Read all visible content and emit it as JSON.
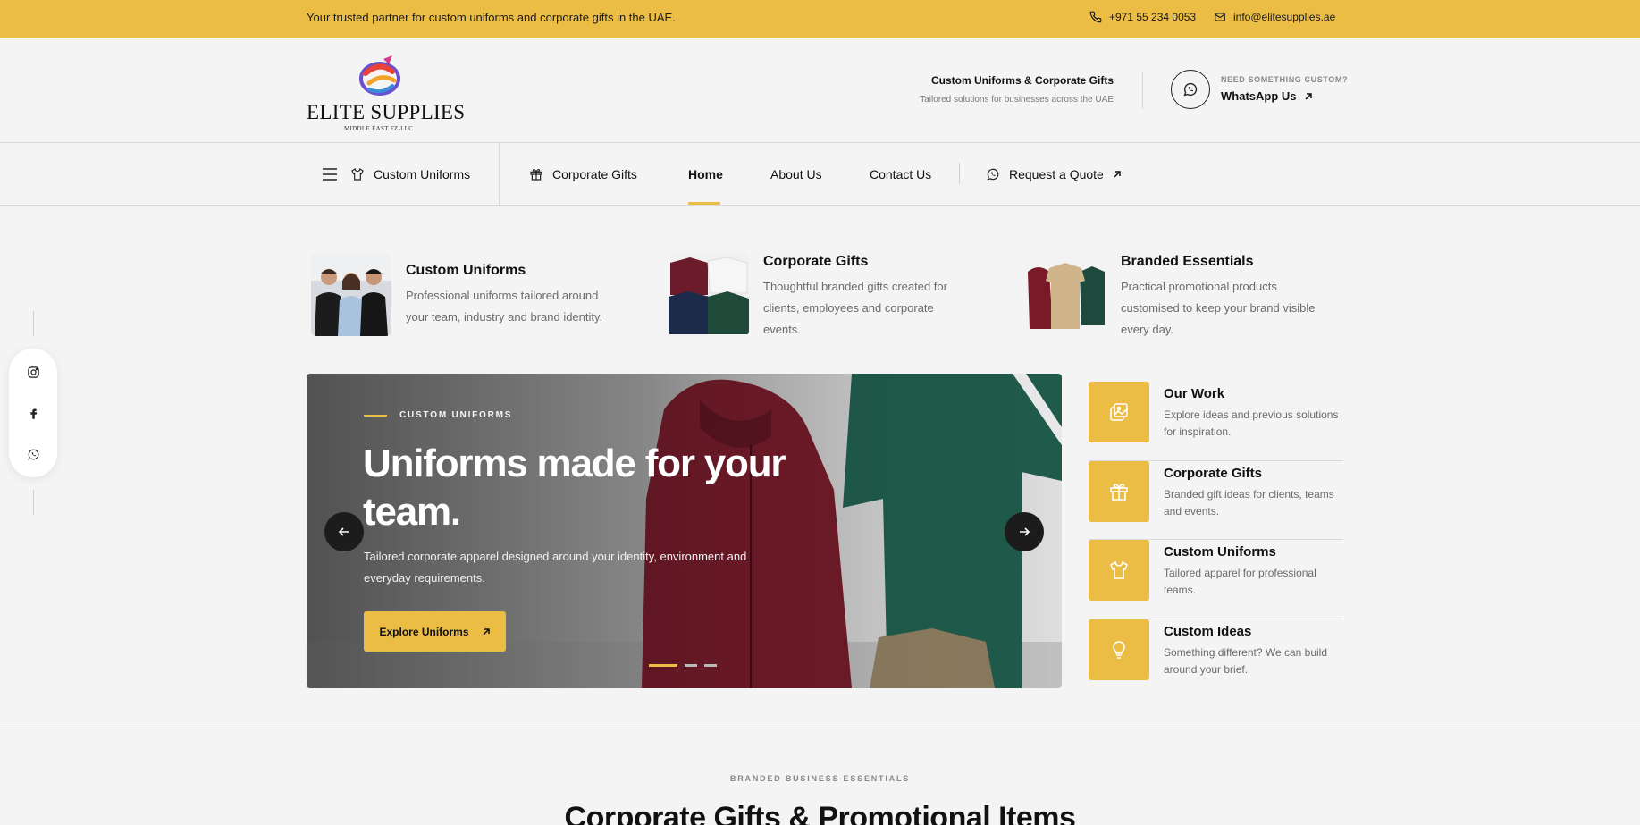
{
  "topbar": {
    "tagline": "Your trusted partner for custom uniforms and corporate gifts in the UAE.",
    "phone": "+971 55 234 0053",
    "email": "info@elitesupplies.ae"
  },
  "logo": {
    "name": "ELITE SUPPLIES",
    "sub": "MIDDLE EAST FZ-LLC"
  },
  "header": {
    "info_title": "Custom Uniforms & Corporate Gifts",
    "info_sub": "Tailored solutions for businesses across the UAE",
    "whatsapp_small": "NEED SOMETHING CUSTOM?",
    "whatsapp_label": "WhatsApp Us"
  },
  "nav": {
    "uniforms": "Custom Uniforms",
    "gifts": "Corporate Gifts",
    "home": "Home",
    "about": "About Us",
    "contact": "Contact Us",
    "quote": "Request a Quote"
  },
  "categories": [
    {
      "title": "Custom Uniforms",
      "desc": "Professional uniforms tailored around your team, industry and brand identity."
    },
    {
      "title": "Corporate Gifts",
      "desc": "Thoughtful branded gifts created for clients, employees and corporate events."
    },
    {
      "title": "Branded Essentials",
      "desc": "Practical promotional products customised to keep your brand visible every day."
    }
  ],
  "hero": {
    "eyebrow": "CUSTOM UNIFORMS",
    "title": "Uniforms made for your team.",
    "sub": "Tailored corporate apparel designed around your identity, environment and everyday requirements.",
    "cta": "Explore Uniforms",
    "active_slide": 1,
    "slide_count": 3
  },
  "sidelist": [
    {
      "title": "Our Work",
      "desc": "Explore ideas and previous solutions for inspiration.",
      "icon": "gallery-icon"
    },
    {
      "title": "Corporate Gifts",
      "desc": "Branded gift ideas for clients, teams and events.",
      "icon": "gift-icon"
    },
    {
      "title": "Custom Uniforms",
      "desc": "Tailored apparel for professional teams.",
      "icon": "shirt-icon"
    },
    {
      "title": "Custom Ideas",
      "desc": "Something different? We can build around your brief.",
      "icon": "lightbulb-icon"
    }
  ],
  "social": [
    "instagram-icon",
    "facebook-icon",
    "whatsapp-icon"
  ],
  "section": {
    "eyebrow": "BRANDED BUSINESS ESSENTIALS",
    "title": "Corporate Gifts & Promotional Items"
  },
  "colors": {
    "accent": "#ecbd45",
    "dark": "#1c1c1c"
  }
}
